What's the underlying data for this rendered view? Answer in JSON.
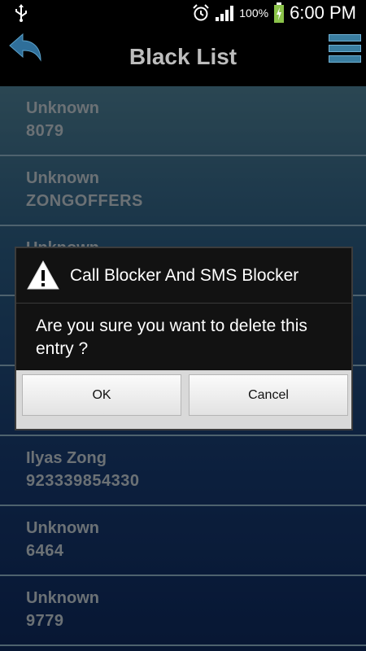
{
  "status_bar": {
    "battery_percent": "100%",
    "time": "6:00 PM"
  },
  "header": {
    "title": "Black List"
  },
  "list": [
    {
      "name": "Unknown",
      "number": "8079"
    },
    {
      "name": "Unknown",
      "number": "ZONGOFFERS"
    },
    {
      "name": "Unknown",
      "number": ""
    },
    {
      "name": "",
      "number": ""
    },
    {
      "name": "",
      "number": ""
    },
    {
      "name": "Ilyas Zong",
      "number": "923339854330"
    },
    {
      "name": "Unknown",
      "number": "6464"
    },
    {
      "name": "Unknown",
      "number": "9779"
    }
  ],
  "dialog": {
    "title": "Call Blocker And SMS Blocker",
    "message": "Are you sure you want to delete this entry ?",
    "ok_label": "OK",
    "cancel_label": "Cancel"
  }
}
